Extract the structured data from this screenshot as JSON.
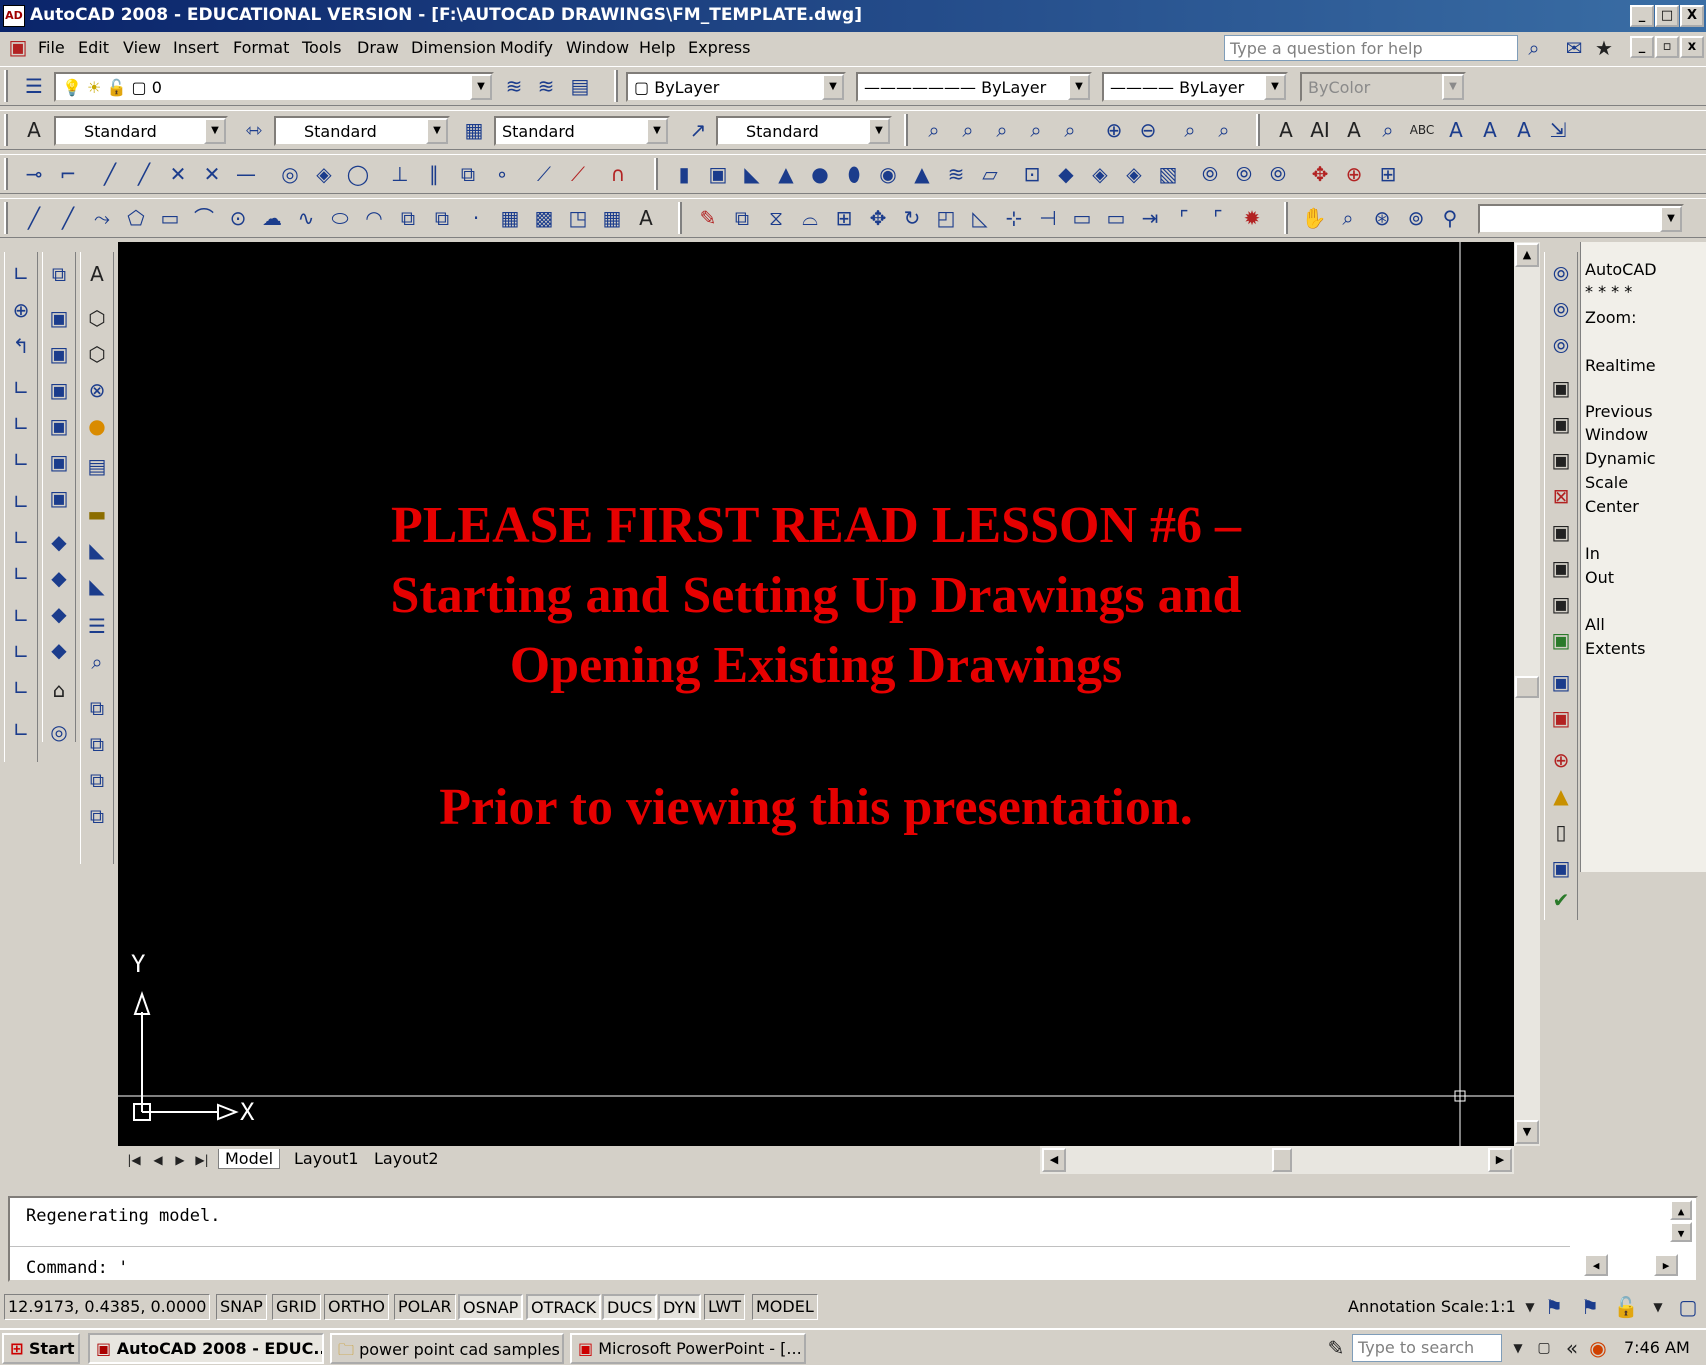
{
  "window": {
    "title": "AutoCAD 2008 - EDUCATIONAL VERSION - [F:\\AUTOCAD DRAWINGS\\FM_TEMPLATE.dwg]",
    "app_icon": "autocad-icon",
    "controls": [
      "_",
      "□",
      "X"
    ]
  },
  "menu": {
    "items": [
      "File",
      "Edit",
      "View",
      "Insert",
      "Format",
      "Tools",
      "Draw",
      "Dimension",
      "Modify",
      "Window",
      "Help",
      "Express"
    ],
    "help_placeholder": "Type a question for help"
  },
  "layers_toolbar": {
    "layer_value": "0",
    "color_value": "ByLayer",
    "linetype_value": "ByLayer",
    "lineweight_value": "ByLayer",
    "plotstyle_value": "ByColor"
  },
  "styles_toolbar": {
    "text_style": "Standard",
    "dim_style": "Standard",
    "table_style": "Standard",
    "mleader_style": "Standard"
  },
  "drawing": {
    "message_line1": "PLEASE FIRST READ LESSON #6 –",
    "message_line2": "Starting and Setting Up Drawings and",
    "message_line3": "Opening Existing Drawings",
    "message_line4": "Prior to viewing this presentation.",
    "message_color": "#e60000",
    "background": "#000000",
    "ucs_y": "Y",
    "ucs_x": "X"
  },
  "layout_tabs": [
    "Model",
    "Layout1",
    "Layout2"
  ],
  "zoom_panel": {
    "lines": [
      "AutoCAD",
      "* * * *",
      "Zoom:",
      "Realtime",
      "Previous",
      "Window",
      "Dynamic",
      "Scale",
      "Center",
      "In",
      "Out",
      "All",
      "Extents"
    ]
  },
  "command_window": {
    "history": "Regenerating model.",
    "prompt": "Command: '"
  },
  "status_bar": {
    "coords": "12.9173, 0.4385, 0.0000",
    "toggles": [
      "SNAP",
      "GRID",
      "ORTHO",
      "POLAR",
      "OSNAP",
      "OTRACK",
      "DUCS",
      "DYN",
      "LWT",
      "MODEL"
    ],
    "annotation_scale_label": "Annotation Scale:",
    "annotation_scale_value": "1:1"
  },
  "taskbar": {
    "start": "Start",
    "buttons": [
      "AutoCAD 2008 - EDUC...",
      "power point cad samples",
      "Microsoft PowerPoint - [..."
    ],
    "search_placeholder": "Type to search",
    "clock": "7:46 AM"
  }
}
